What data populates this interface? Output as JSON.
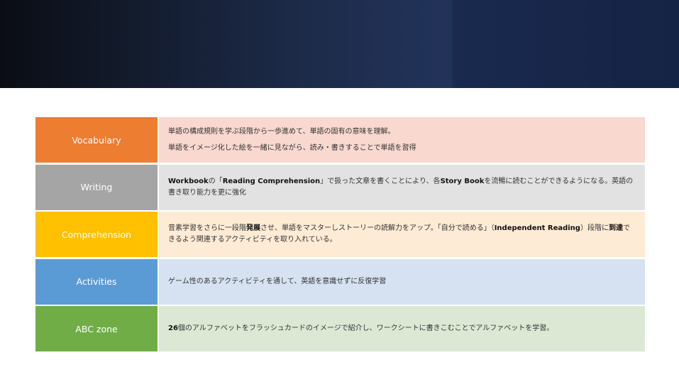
{
  "colors": {
    "vocabulary": {
      "label_bg": "#ED7D31",
      "content_bg": "#F8D8CF"
    },
    "writing": {
      "label_bg": "#A5A5A5",
      "content_bg": "#E2E2E2"
    },
    "comprehension": {
      "label_bg": "#FFC000",
      "content_bg": "#FDEBD5"
    },
    "activities": {
      "label_bg": "#5B9BD5",
      "content_bg": "#D6E2F2"
    },
    "abc_zone": {
      "label_bg": "#70AD47",
      "content_bg": "#DCE8D4"
    }
  },
  "rows": [
    {
      "label": "Vocabulary",
      "lines": [
        "単語の構成規則を学ぶ段階から一歩進めて、単語の固有の意味を理解。",
        "単語をイメージ化した絵を一緒に見ながら、読み・書きすることで単語を習得"
      ]
    },
    {
      "label": "Writing",
      "segments": [
        {
          "text": "Workbook",
          "bold": true
        },
        {
          "text": "の「",
          "bold": false
        },
        {
          "text": "Reading Comprehension",
          "bold": true
        },
        {
          "text": "」で扱った文章を書くことにより、各",
          "bold": false
        },
        {
          "text": "Story Book",
          "bold": true
        },
        {
          "text": "を流暢に読むことができるようになる。英語の書き取り能力を更に強化",
          "bold": false
        }
      ]
    },
    {
      "label": "Comprehension",
      "segments": [
        {
          "text": "音素学習をさらに一段階",
          "bold": false
        },
        {
          "text": "発展",
          "bold": true
        },
        {
          "text": "させ、単語をマスターしストーリーの読解力をアップ。「自分で読める」（",
          "bold": false
        },
        {
          "text": "Independent Reading",
          "bold": true
        },
        {
          "text": "）段階に",
          "bold": false
        },
        {
          "text": "到達",
          "bold": true
        },
        {
          "text": "できるよう関連するアクティビティを取り入れている。",
          "bold": false
        }
      ]
    },
    {
      "label": "Activities",
      "lines": [
        "ゲーム性のあるアクティビティを通して、英語を意識せずに反復学習"
      ]
    },
    {
      "label": "ABC zone",
      "segments": [
        {
          "text": "26",
          "bold": true
        },
        {
          "text": "個のアルファベットをフラッシュカードのイメージで紹介し、ワークシートに書きこむことでアルファベットを学習。",
          "bold": false
        }
      ]
    }
  ]
}
